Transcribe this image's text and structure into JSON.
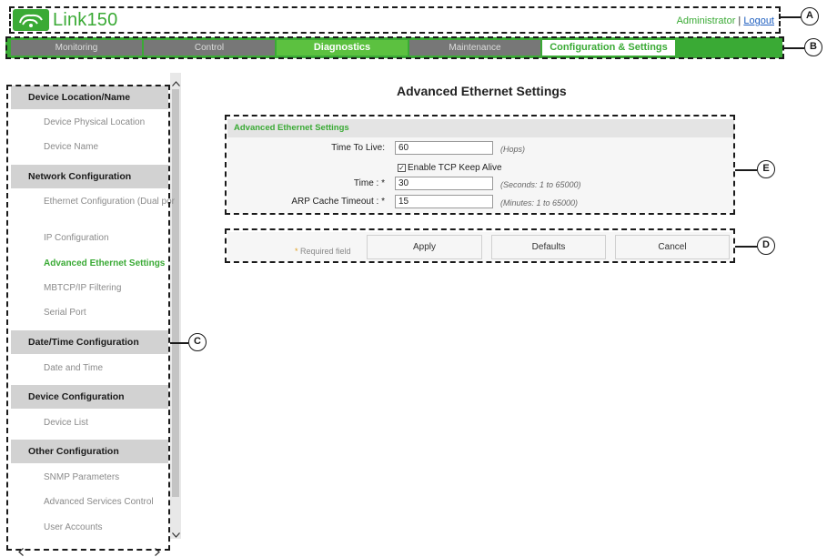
{
  "header": {
    "app_name": "Link150",
    "user": "Administrator",
    "separator": "|",
    "logout": "Logout"
  },
  "nav": {
    "tabs": [
      {
        "label": "Monitoring"
      },
      {
        "label": "Control"
      },
      {
        "label": "Diagnostics"
      },
      {
        "label": "Maintenance"
      },
      {
        "label": "Configuration & Settings"
      }
    ]
  },
  "sidebar": {
    "sections": [
      {
        "title": "Device Location/Name",
        "items": [
          "Device Physical Location",
          "Device Name"
        ]
      },
      {
        "title": "Network Configuration",
        "items": [
          "Ethernet Configuration (Dual port)",
          "IP Configuration",
          "Advanced Ethernet Settings",
          "MBTCP/IP Filtering",
          "Serial Port"
        ]
      },
      {
        "title": "Date/Time Configuration",
        "items": [
          "Date and Time"
        ]
      },
      {
        "title": "Device Configuration",
        "items": [
          "Device List"
        ]
      },
      {
        "title": "Other Configuration",
        "items": [
          "SNMP Parameters",
          "Advanced Services Control",
          "User Accounts"
        ]
      }
    ],
    "active_item": "Advanced Ethernet Settings"
  },
  "main": {
    "page_title": "Advanced Ethernet Settings",
    "panel_title": "Advanced Ethernet Settings",
    "fields": {
      "ttl": {
        "label": "Time To Live:",
        "value": "60",
        "hint": "(Hops)"
      },
      "keepalive": {
        "label": "Enable TCP Keep Alive",
        "checked": true,
        "check_glyph": "✓"
      },
      "time": {
        "label": "Time : *",
        "value": "30",
        "hint": "(Seconds: 1 to 65000)"
      },
      "arp": {
        "label": "ARP Cache Timeout : *",
        "value": "15",
        "hint": "(Minutes: 1 to 65000)"
      }
    },
    "required_star": "*",
    "required_note": "Required field",
    "buttons": {
      "apply": "Apply",
      "defaults": "Defaults",
      "cancel": "Cancel"
    }
  },
  "callouts": {
    "a": "A",
    "b": "B",
    "c": "C",
    "d": "D",
    "e": "E"
  },
  "icons": {
    "logo": "link150-logo-icon",
    "scroll_up": "chevron-up-icon",
    "scroll_down": "chevron-down-icon",
    "scroll_left": "chevron-left-icon",
    "scroll_right": "chevron-right-icon"
  },
  "colors": {
    "brand_green": "#3aaa35",
    "tab_gray": "#777777",
    "link_blue": "#2060c0",
    "sidebar_header": "#d2d2d2"
  }
}
